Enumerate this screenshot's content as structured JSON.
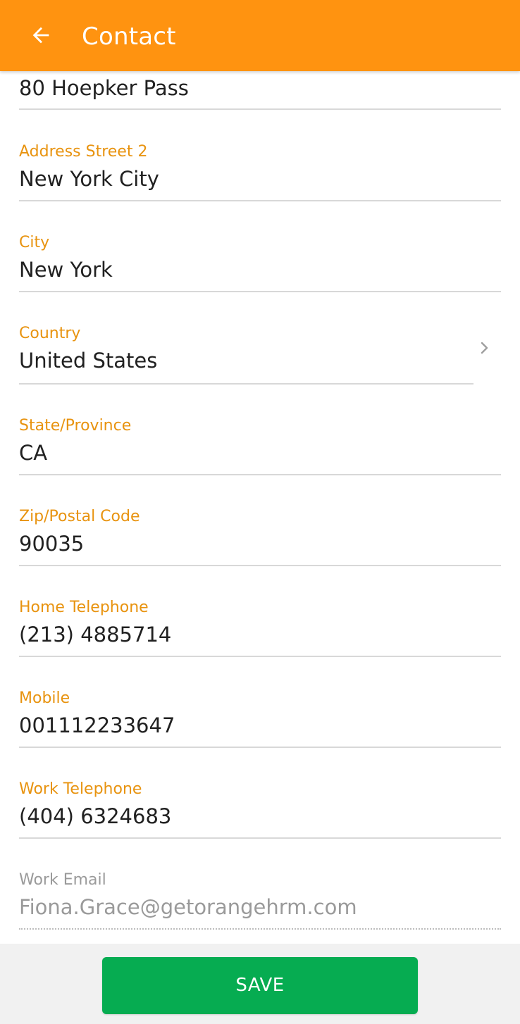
{
  "app_bar": {
    "title": "Contact",
    "back_icon": "arrow-left-icon",
    "color": "#FF9310"
  },
  "form": {
    "address_street_1": {
      "value": "80 Hoepker Pass"
    },
    "address_street_2": {
      "label": "Address Street 2",
      "value": "New York City"
    },
    "city": {
      "label": "City",
      "value": "New York"
    },
    "country": {
      "label": "Country",
      "value": "United States",
      "icon": "chevron-right-icon"
    },
    "state_province": {
      "label": "State/Province",
      "value": "CA"
    },
    "zip_postal_code": {
      "label": "Zip/Postal Code",
      "value": "90035"
    },
    "home_telephone": {
      "label": "Home Telephone",
      "value": "(213) 4885714"
    },
    "mobile": {
      "label": "Mobile",
      "value": "001112233647"
    },
    "work_telephone": {
      "label": "Work Telephone",
      "value": "(404) 6324683"
    },
    "work_email": {
      "label": "Work Email",
      "value": "Fiona.Grace@getorangehrm.com"
    }
  },
  "actions": {
    "save_label": "SAVE",
    "save_color": "#06AC51"
  },
  "colors": {
    "label": "#E8930F",
    "text": "#212121",
    "disabled": "#9a9a9a"
  }
}
